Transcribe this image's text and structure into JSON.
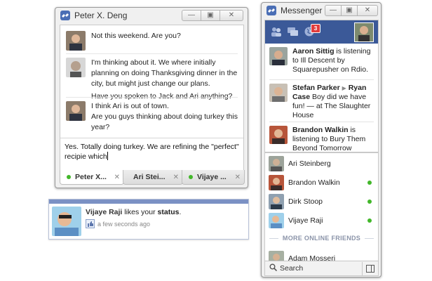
{
  "chat": {
    "title": "Peter X. Deng",
    "window_buttons": {
      "minimize": "—",
      "popout": "▣",
      "close": "✕"
    },
    "messages": [
      {
        "lines": [
          "Not this weekend. Are you?"
        ]
      },
      {
        "lines": [
          "I'm thinking about it. We where initially planning on doing Thanksgiving dinner in the city, but might just change our plans.",
          "Have you spoken to Jack and Ari anything?"
        ]
      },
      {
        "lines": [
          "I think Ari is out of town.",
          "Are you guys thinking about doing turkey this year?"
        ]
      }
    ],
    "compose_text": "Yes. Totally doing turkey. We are refining the \"perfect\" recipie which",
    "tabs": [
      {
        "label": "Peter X...",
        "close": "✕",
        "online": true
      },
      {
        "label": "Ari Stei...",
        "close": "✕",
        "online": false
      },
      {
        "label": "Vijaye ...",
        "close": "✕",
        "online": true
      }
    ]
  },
  "notification": {
    "actor": "Vijaye Raji",
    "verb": " likes your ",
    "object": "status",
    "period": ".",
    "time": "a few seconds ago"
  },
  "messenger": {
    "title": "Messenger",
    "window_buttons": {
      "minimize": "—",
      "popout": "▣",
      "close": "✕"
    },
    "badge_count": "3",
    "stories": [
      {
        "name": "Aaron Sittig",
        "text": " is listening to Ill Descent by Squarepusher on Rdio."
      },
      {
        "name": "Stefan Parker",
        "arrow": "▶",
        "name2": "Ryan Case",
        "text": " Boy did we have fun! — at The Slaughter House"
      },
      {
        "name": "Brandon Walkin",
        "text": " is listening to Bury Them Beyond Tomorrow"
      }
    ],
    "friends": [
      {
        "name": "Ari Steinberg",
        "online": false
      },
      {
        "name": "Brandon Walkin",
        "online": true
      },
      {
        "name": "Dirk Stoop",
        "online": true
      },
      {
        "name": "Vijaye Raji",
        "online": true
      }
    ],
    "more_label": "MORE ONLINE FRIENDS",
    "more_friends": [
      {
        "name": "Adam Mosseri"
      }
    ],
    "search_label": "Search"
  },
  "colors": {
    "facebook_blue": "#3b5998",
    "online_green": "#42b72a",
    "badge_red": "#e23c3c"
  }
}
